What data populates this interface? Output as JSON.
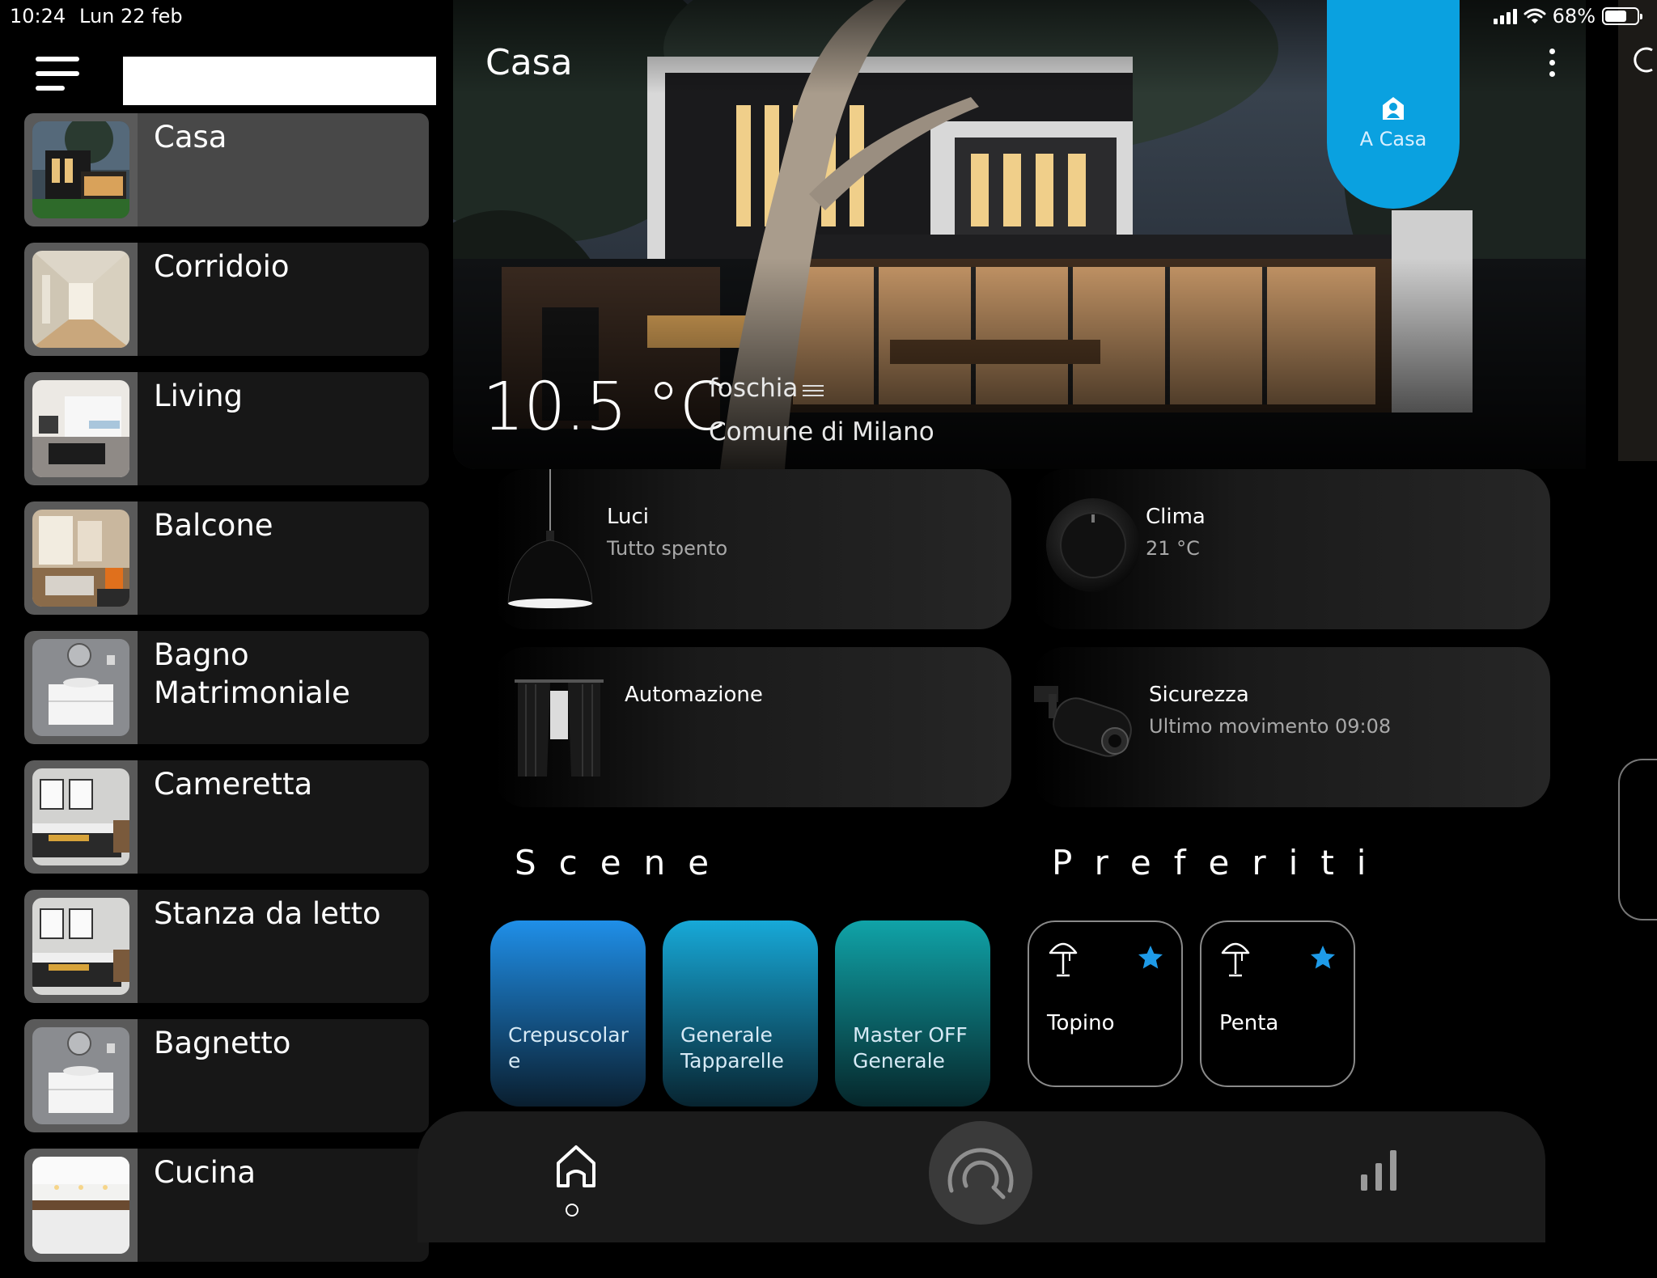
{
  "status_bar": {
    "time": "10:24",
    "date": "Lun 22 feb",
    "battery": "68%",
    "battery_level": 0.68
  },
  "sidebar": {
    "search_placeholder": "",
    "rooms": [
      {
        "name": "Casa",
        "active": true
      },
      {
        "name": "Corridoio",
        "active": false
      },
      {
        "name": "Living",
        "active": false
      },
      {
        "name": "Balcone",
        "active": false
      },
      {
        "name": "Bagno Matrimoniale",
        "active": false
      },
      {
        "name": "Cameretta",
        "active": false
      },
      {
        "name": "Stanza da letto",
        "active": false
      },
      {
        "name": "Bagnetto",
        "active": false
      },
      {
        "name": "Cucina",
        "active": false
      }
    ]
  },
  "header": {
    "title": "Casa",
    "presence_label": "A Casa"
  },
  "weather": {
    "temperature": "10.5 °C",
    "condition": "foschia",
    "location": "Comune di Milano"
  },
  "tiles": [
    {
      "title": "Luci",
      "subtitle": "Tutto spento",
      "icon": "pendant-lamp-icon"
    },
    {
      "title": "Clima",
      "subtitle": "21 °C",
      "icon": "thermostat-icon"
    },
    {
      "title": "Automazione",
      "subtitle": "",
      "icon": "curtain-icon"
    },
    {
      "title": "Sicurezza",
      "subtitle": "Ultimo movimento 09:08",
      "icon": "security-camera-icon"
    }
  ],
  "scenes": {
    "title": "Scene",
    "items": [
      {
        "label": "Crepuscolar e",
        "gradient_top": "#1f8fe8",
        "gradient_bottom": "#0a1e2e"
      },
      {
        "label": "Generale Tapparelle",
        "gradient_top": "#17a9d8",
        "gradient_bottom": "#082430"
      },
      {
        "label": "Master OFF Generale",
        "gradient_top": "#10a3a8",
        "gradient_bottom": "#06262a"
      }
    ]
  },
  "favorites": {
    "title": "Preferiti",
    "items": [
      {
        "label": "Topino",
        "icon": "table-lamp-icon",
        "starred": true
      },
      {
        "label": "Penta",
        "icon": "table-lamp-icon",
        "starred": true
      }
    ]
  },
  "colors": {
    "accent": "#0aa1e0",
    "star": "#1e9be8",
    "tile_bg": "#262626"
  }
}
